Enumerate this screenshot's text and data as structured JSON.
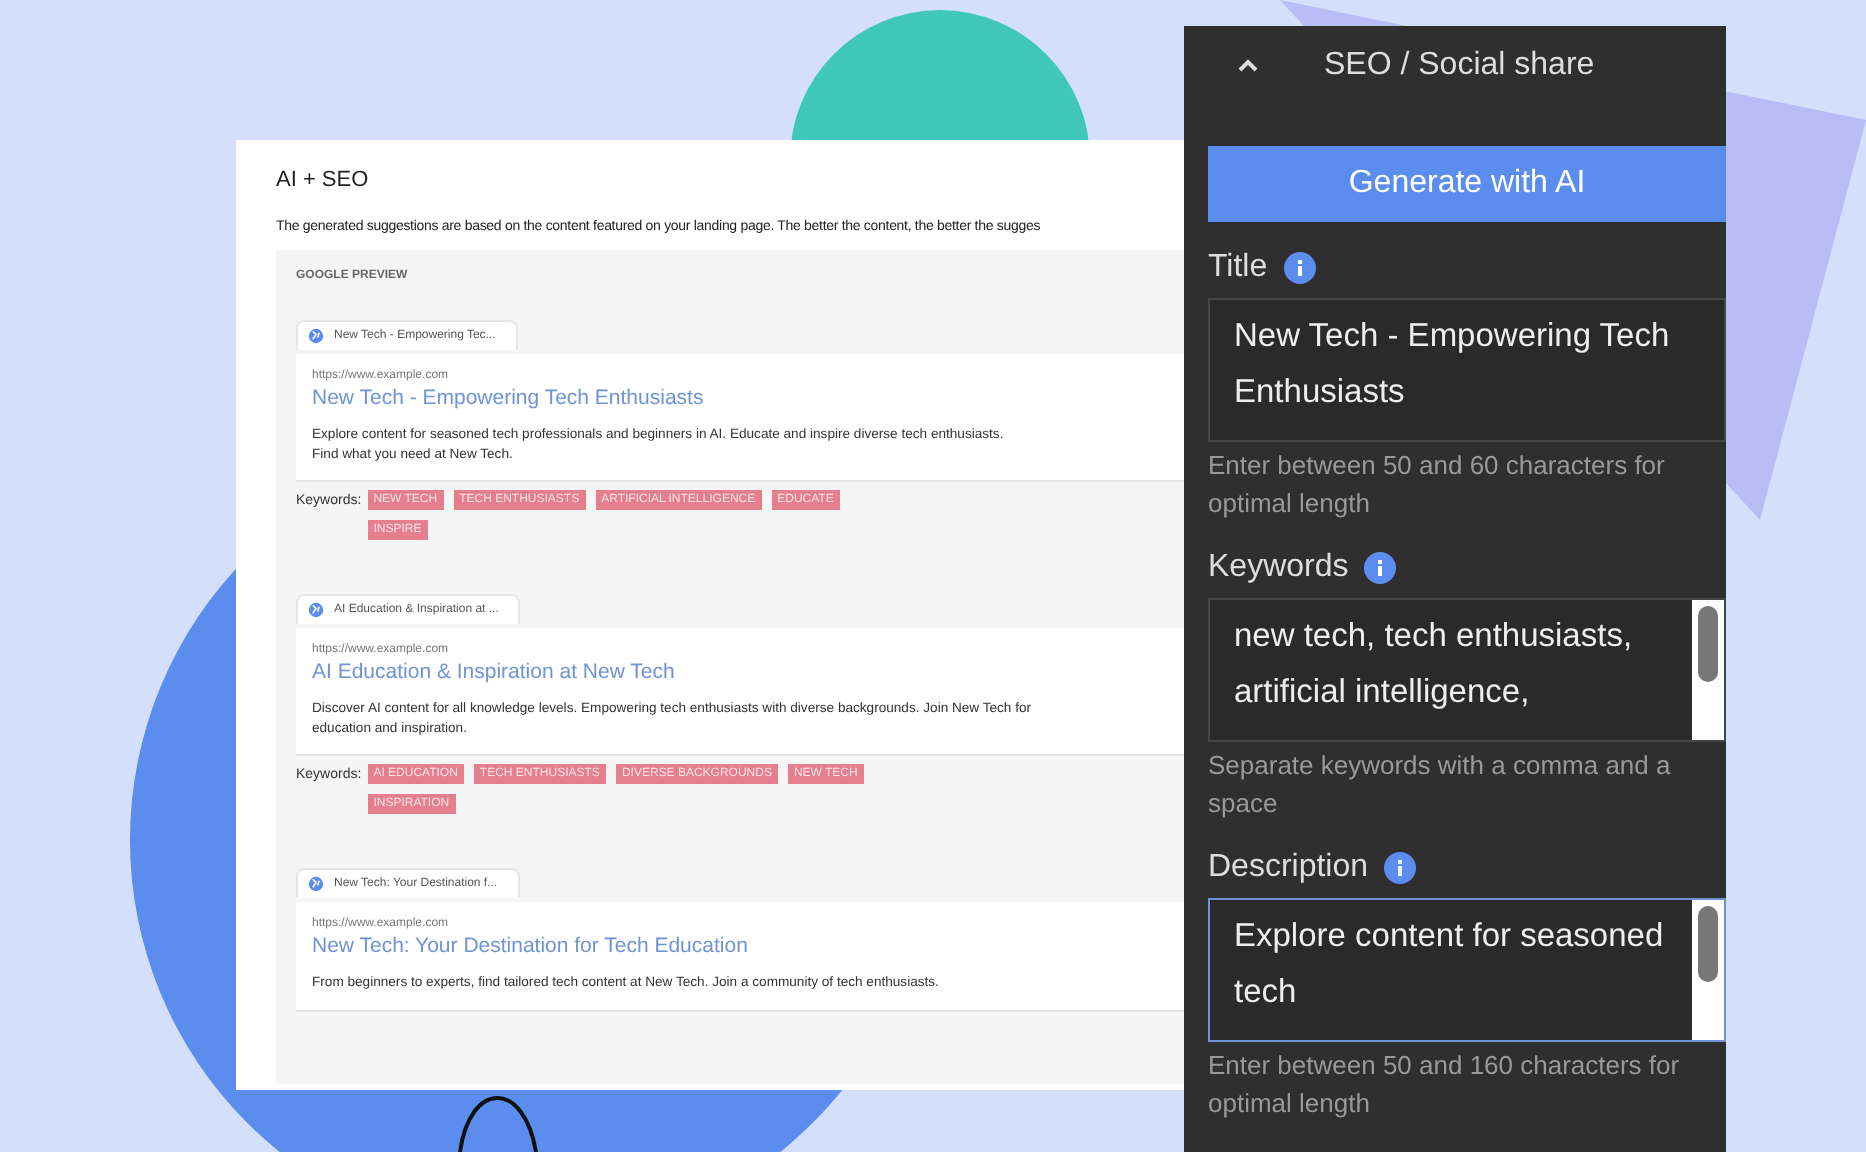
{
  "card": {
    "title": "AI + SEO",
    "intro": "The generated suggestions are based on the content featured on your landing page. The better the content, the better the sugges",
    "preview_heading": "GOOGLE PREVIEW",
    "results": [
      {
        "tab_title": "New Tech - Empowering Tec...",
        "url": "https://www.example.com",
        "title": "New Tech - Empowering Tech Enthusiasts",
        "snippet": "Explore content for seasoned tech professionals and beginners in AI. Educate and inspire diverse tech enthusiasts. Find what you need at New Tech.",
        "keywords_label": "Keywords:",
        "keywords": [
          "NEW TECH",
          "TECH ENTHUSIASTS",
          "ARTIFICIAL INTELLIGENCE",
          "EDUCATE",
          "INSPIRE"
        ]
      },
      {
        "tab_title": "AI Education & Inspiration at ...",
        "url": "https://www.example.com",
        "title": "AI Education & Inspiration at New Tech",
        "snippet": "Discover AI content for all knowledge levels. Empowering tech enthusiasts with diverse backgrounds. Join New Tech for education and inspiration.",
        "keywords_label": "Keywords:",
        "keywords": [
          "AI EDUCATION",
          "TECH ENTHUSIASTS",
          "DIVERSE BACKGROUNDS",
          "NEW TECH",
          "INSPIRATION"
        ]
      },
      {
        "tab_title": "New Tech: Your Destination f...",
        "url": "https://www.example.com",
        "title": "New Tech: Your Destination for Tech Education",
        "snippet": "From beginners to experts, find tailored tech content at New Tech. Join a community of tech enthusiasts."
      }
    ]
  },
  "panel": {
    "title": "SEO / Social share",
    "expanded": true,
    "generate_button": "Generate with AI",
    "fields": [
      {
        "label": "Title",
        "value": "New Tech - Empowering Tech Enthusiasts",
        "help": "Enter between 50 and 60 characters for optimal length",
        "focused": false,
        "scrollbar": false
      },
      {
        "label": "Keywords",
        "value": "new tech, tech enthusiasts, artificial intelligence,",
        "help": "Separate keywords with a comma and a space",
        "focused": false,
        "scrollbar": true
      },
      {
        "label": "Description",
        "value": "Explore content for seasoned tech",
        "help": "Enter between 50 and 160 characters for optimal length",
        "focused": true,
        "scrollbar": true
      }
    ]
  }
}
